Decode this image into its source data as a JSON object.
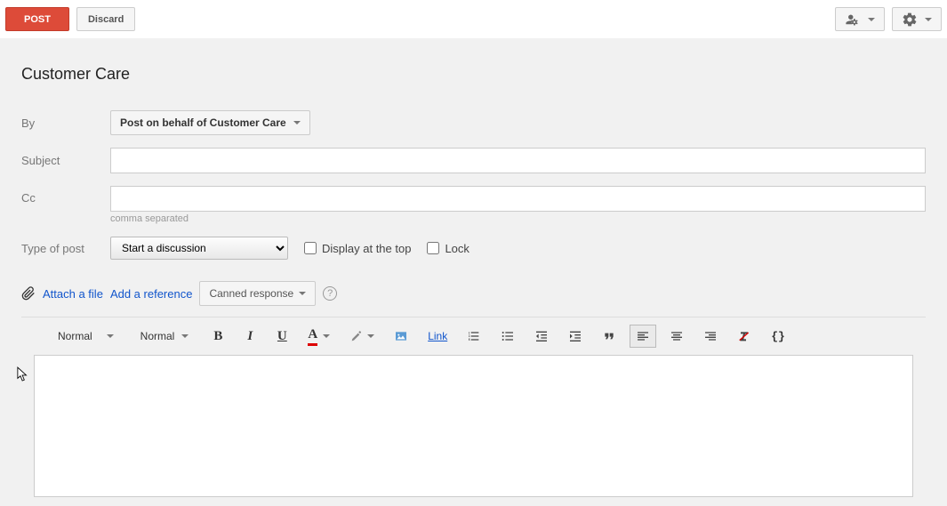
{
  "top": {
    "post_label": "Post",
    "discard_label": "Discard"
  },
  "page_title": "Customer Care",
  "form": {
    "by_label": "By",
    "behalf_text": "Post on behalf of Customer Care",
    "subject_label": "Subject",
    "subject_value": "",
    "cc_label": "Cc",
    "cc_value": "",
    "cc_hint": "comma separated",
    "type_label": "Type of post",
    "type_selected": "Start a discussion",
    "display_top_label": "Display at the top",
    "lock_label": "Lock"
  },
  "attach": {
    "attach_file": "Attach a file",
    "add_reference": "Add a reference",
    "canned_label": "Canned response"
  },
  "toolbar": {
    "block_format": "Normal",
    "font_family": "Normal",
    "link_label": "Link"
  }
}
